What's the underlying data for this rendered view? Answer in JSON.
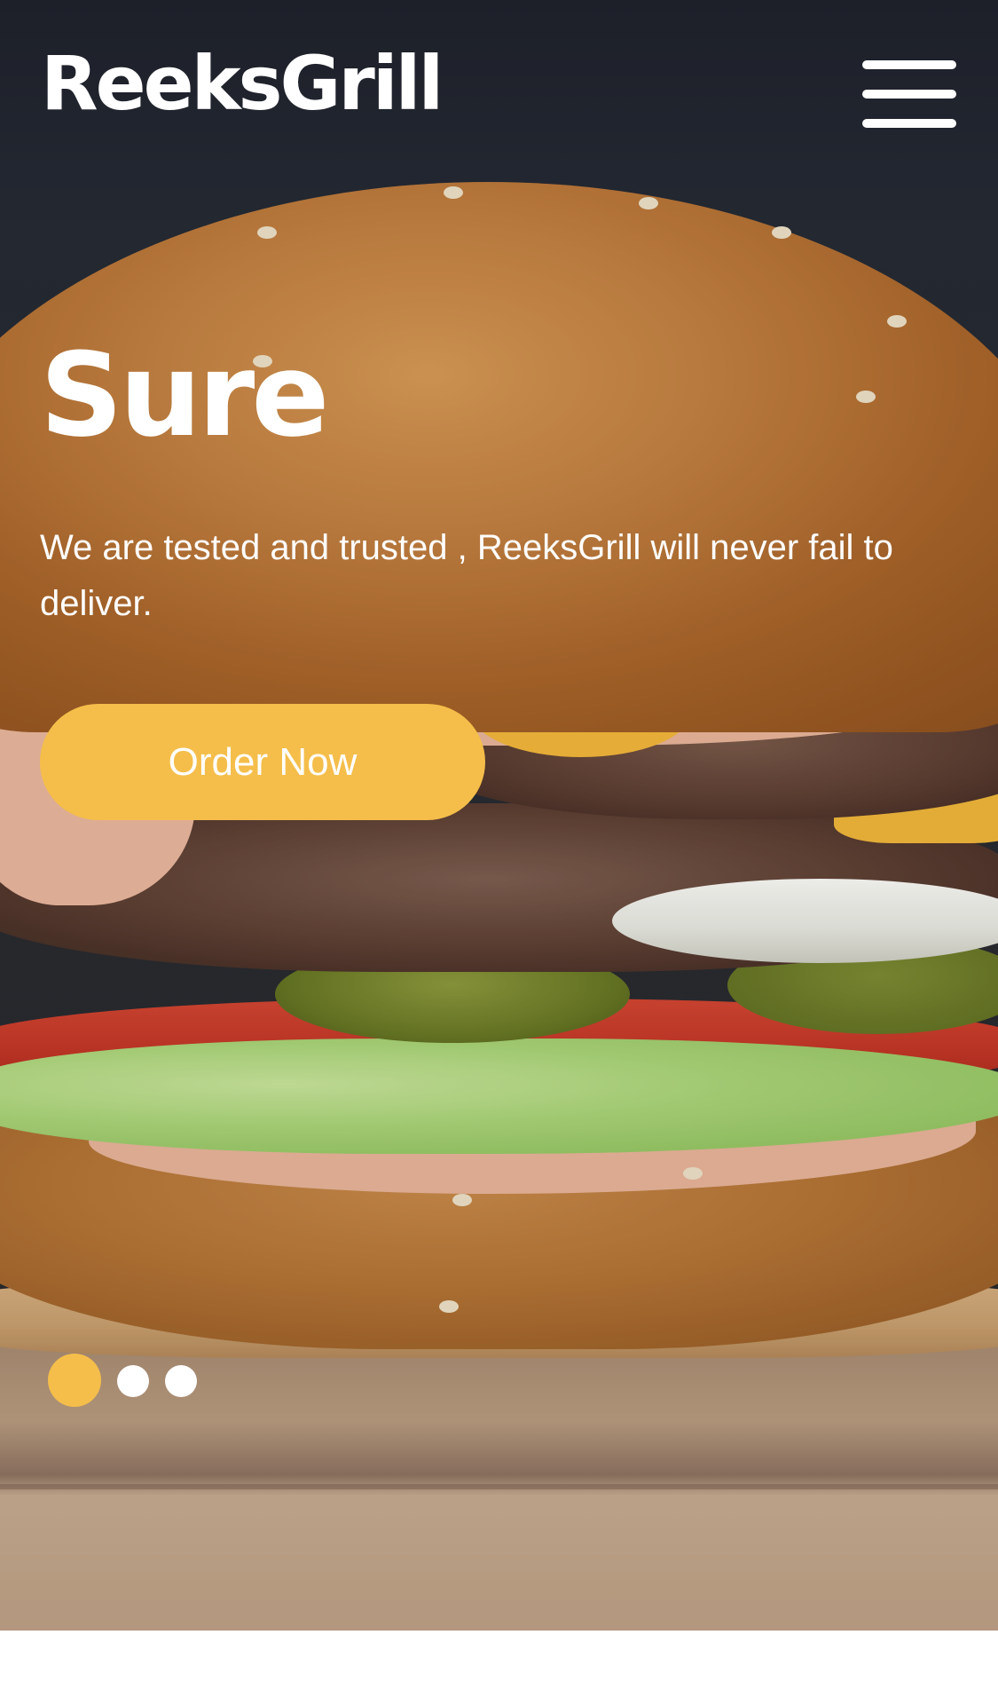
{
  "header": {
    "logo": "ReeksGrill",
    "menu_icon": "hamburger-menu-icon"
  },
  "hero": {
    "title": "Sure",
    "description": "We are tested and trusted , ReeksGrill will never fail to deliver.",
    "cta_label": "Order Now",
    "background_image": "burger photo"
  },
  "carousel": {
    "slide_count": 3,
    "active_index": 0
  },
  "colors": {
    "accent": "#f5be4a",
    "text": "#ffffff",
    "background_dark": "#232731"
  }
}
